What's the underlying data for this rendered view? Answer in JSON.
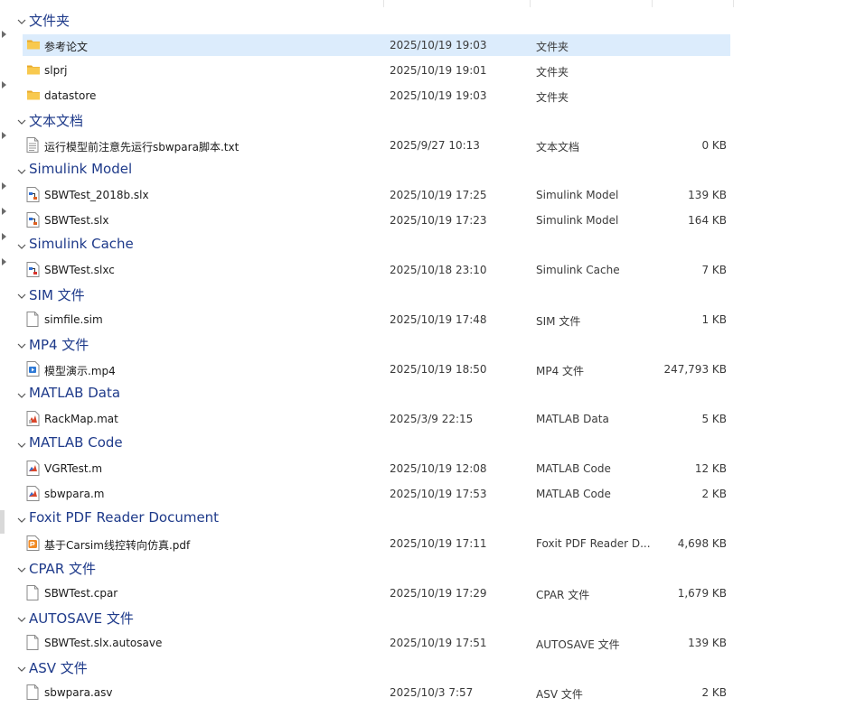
{
  "groups": [
    {
      "title": "文件夹",
      "items": [
        {
          "name": "参考论文",
          "date": "2025/10/19 19:03",
          "type": "文件夹",
          "size": "",
          "icon": "folder-icon",
          "selected": true
        },
        {
          "name": "slprj",
          "date": "2025/10/19 19:01",
          "type": "文件夹",
          "size": "",
          "icon": "folder-icon"
        },
        {
          "name": "datastore",
          "date": "2025/10/19 19:03",
          "type": "文件夹",
          "size": "",
          "icon": "folder-icon"
        }
      ]
    },
    {
      "title": "文本文档",
      "items": [
        {
          "name": "运行模型前注意先运行sbwpara脚本.txt",
          "date": "2025/9/27 10:13",
          "type": "文本文档",
          "size": "0 KB",
          "icon": "text-file-icon"
        }
      ]
    },
    {
      "title": "Simulink Model",
      "items": [
        {
          "name": "SBWTest_2018b.slx",
          "date": "2025/10/19 17:25",
          "type": "Simulink Model",
          "size": "139 KB",
          "icon": "simulink-model-icon"
        },
        {
          "name": "SBWTest.slx",
          "date": "2025/10/19 17:23",
          "type": "Simulink Model",
          "size": "164 KB",
          "icon": "simulink-model-icon"
        }
      ]
    },
    {
      "title": "Simulink Cache",
      "items": [
        {
          "name": "SBWTest.slxc",
          "date": "2025/10/18 23:10",
          "type": "Simulink Cache",
          "size": "7 KB",
          "icon": "simulink-cache-icon"
        }
      ]
    },
    {
      "title": "SIM 文件",
      "items": [
        {
          "name": "simfile.sim",
          "date": "2025/10/19 17:48",
          "type": "SIM 文件",
          "size": "1 KB",
          "icon": "blank-file-icon"
        }
      ]
    },
    {
      "title": "MP4 文件",
      "items": [
        {
          "name": "模型演示.mp4",
          "date": "2025/10/19 18:50",
          "type": "MP4 文件",
          "size": "247,793 KB",
          "icon": "video-file-icon"
        }
      ]
    },
    {
      "title": "MATLAB Data",
      "items": [
        {
          "name": "RackMap.mat",
          "date": "2025/3/9 22:15",
          "type": "MATLAB Data",
          "size": "5 KB",
          "icon": "matlab-data-icon"
        }
      ]
    },
    {
      "title": "MATLAB Code",
      "items": [
        {
          "name": "VGRTest.m",
          "date": "2025/10/19 12:08",
          "type": "MATLAB Code",
          "size": "12 KB",
          "icon": "matlab-code-icon"
        },
        {
          "name": "sbwpara.m",
          "date": "2025/10/19 17:53",
          "type": "MATLAB Code",
          "size": "2 KB",
          "icon": "matlab-code-icon"
        }
      ]
    },
    {
      "title": "Foxit PDF Reader Document",
      "items": [
        {
          "name": "基于Carsim线控转向仿真.pdf",
          "date": "2025/10/19 17:11",
          "type": "Foxit PDF Reader D...",
          "size": "4,698 KB",
          "icon": "pdf-file-icon"
        }
      ]
    },
    {
      "title": "CPAR 文件",
      "items": [
        {
          "name": "SBWTest.cpar",
          "date": "2025/10/19 17:29",
          "type": "CPAR 文件",
          "size": "1,679 KB",
          "icon": "blank-file-icon"
        }
      ]
    },
    {
      "title": "AUTOSAVE 文件",
      "items": [
        {
          "name": "SBWTest.slx.autosave",
          "date": "2025/10/19 17:51",
          "type": "AUTOSAVE 文件",
          "size": "139 KB",
          "icon": "blank-file-icon"
        }
      ]
    },
    {
      "title": "ASV 文件",
      "items": [
        {
          "name": "sbwpara.asv",
          "date": "2025/10/3 7:57",
          "type": "ASV 文件",
          "size": "2 KB",
          "icon": "blank-file-icon"
        }
      ]
    }
  ],
  "colors": {
    "group_title": "#1e3a8a",
    "selection": "#dcecfc",
    "folder": "#f5c244"
  }
}
